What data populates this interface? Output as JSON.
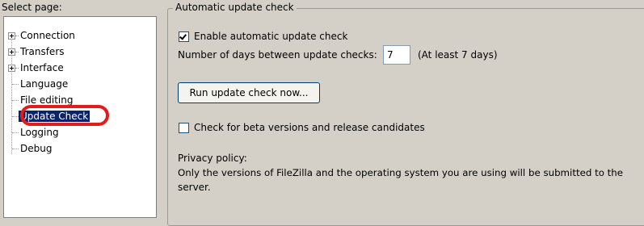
{
  "sidebar": {
    "heading": "Select page:",
    "items": [
      {
        "label": "Connection"
      },
      {
        "label": "Transfers"
      },
      {
        "label": "Interface"
      },
      {
        "label": "Language"
      },
      {
        "label": "File editing"
      },
      {
        "label": "Update Check"
      },
      {
        "label": "Logging"
      },
      {
        "label": "Debug"
      }
    ],
    "selected": "Update Check"
  },
  "update_check": {
    "group_title": "Automatic update check",
    "enable_checkbox_label": "Enable automatic update check",
    "enable_checked": true,
    "days_label": "Number of days between update checks:",
    "days_value": "7",
    "days_hint": "(At least 7 days)",
    "run_button_label": "Run update check now...",
    "beta_checkbox_label": "Check for beta versions and release candidates",
    "beta_checked": false,
    "privacy_heading": "Privacy policy:",
    "privacy_line1": "Only the versions of FileZilla and the operating system you are using will be submitted to the",
    "privacy_line2": "server."
  },
  "colors": {
    "dialog_bg": "#d4d0c8",
    "selection_bg": "#0a246a",
    "highlight_ring": "#e21b1b"
  }
}
